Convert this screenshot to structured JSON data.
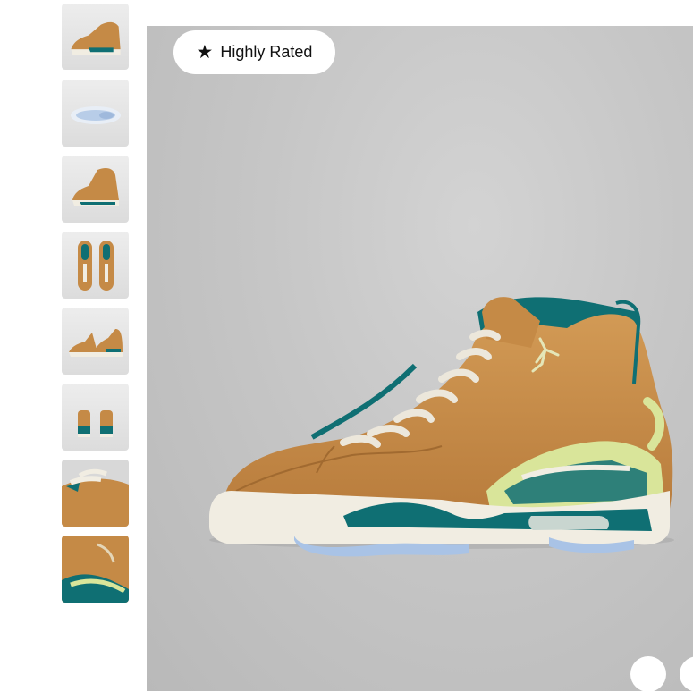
{
  "badge": {
    "label": "Highly Rated",
    "icon": "star-icon"
  },
  "gallery": {
    "thumbnails": [
      {
        "view": "lateral-pair"
      },
      {
        "view": "sole"
      },
      {
        "view": "medial"
      },
      {
        "view": "top-down"
      },
      {
        "view": "front-pair"
      },
      {
        "view": "heel-pair"
      },
      {
        "view": "detail-toe"
      },
      {
        "view": "detail-heel"
      }
    ]
  },
  "colors": {
    "leather": "#c58a46",
    "teal": "#0f6f73",
    "sole": "#f1ede2",
    "ice": "#a9c3e6",
    "accent_lime": "#d9e59a",
    "background": "#c6c6c6"
  }
}
